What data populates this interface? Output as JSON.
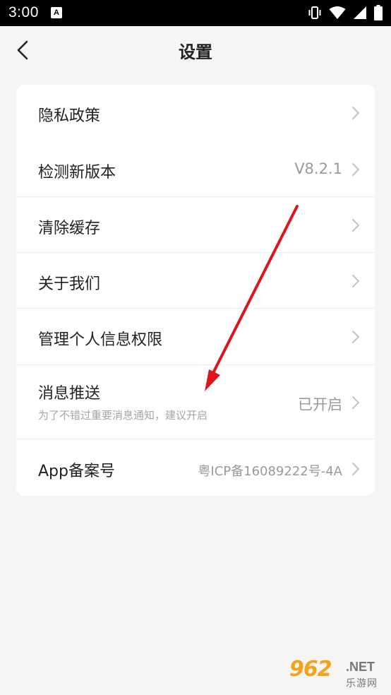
{
  "status_bar": {
    "time": "3:00",
    "notification_icon": "a-notification-icon",
    "right_icons": [
      "vibrate-icon",
      "wifi-icon",
      "signal-icon",
      "battery-icon"
    ]
  },
  "header": {
    "title": "设置",
    "back_icon": "chevron-left-icon"
  },
  "settings": {
    "items": [
      {
        "label": "隐私政策",
        "value": "",
        "subtitle": ""
      },
      {
        "label": "检测新版本",
        "value": "V8.2.1",
        "subtitle": ""
      },
      {
        "label": "清除缓存",
        "value": "",
        "subtitle": ""
      },
      {
        "label": "关于我们",
        "value": "",
        "subtitle": ""
      },
      {
        "label": "管理个人信息权限",
        "value": "",
        "subtitle": ""
      },
      {
        "label": "消息推送",
        "value": "已开启",
        "subtitle": "为了不错过重要消息通知，建议开启"
      },
      {
        "label": "App备案号",
        "value": "粤ICP备16089222号-4A",
        "subtitle": ""
      }
    ]
  },
  "annotation": {
    "color": "#e0141c"
  },
  "watermark": {
    "number": "962",
    "domain": ".NET",
    "site": "乐游网"
  },
  "colors": {
    "background": "#f5f5f5",
    "card": "#ffffff",
    "primary_text": "#222222",
    "secondary_text": "#9a9a9a"
  }
}
